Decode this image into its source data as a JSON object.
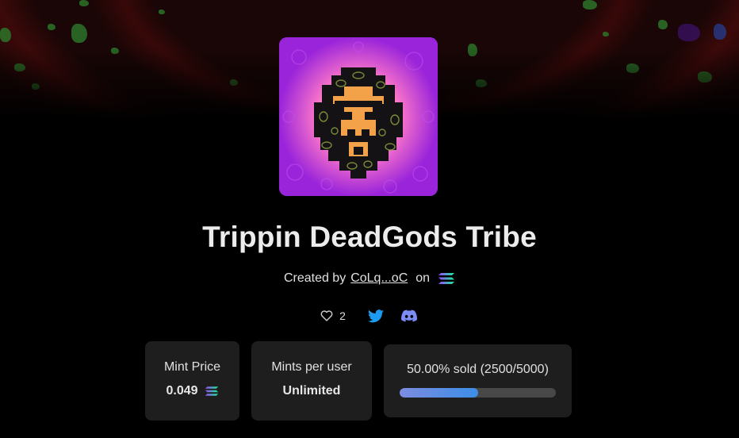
{
  "collection": {
    "name": "Trippin DeadGods Tribe",
    "created_by_label": "Created by",
    "creator": "CoLq...oC",
    "on_label": "on",
    "chain_icon": "solana-icon"
  },
  "social": {
    "likes_count": "2",
    "like_icon": "heart-icon",
    "twitter_icon": "twitter-icon",
    "discord_icon": "discord-icon",
    "twitter_color": "#1d9bf0",
    "discord_color": "#7b8cf5"
  },
  "stats": {
    "mint_price_label": "Mint Price",
    "mint_price_value": "0.049",
    "mints_per_user_label": "Mints per user",
    "mints_per_user_value": "Unlimited",
    "sold_label": "50.00% sold (2500/5000)",
    "sold_fraction": 0.5
  }
}
